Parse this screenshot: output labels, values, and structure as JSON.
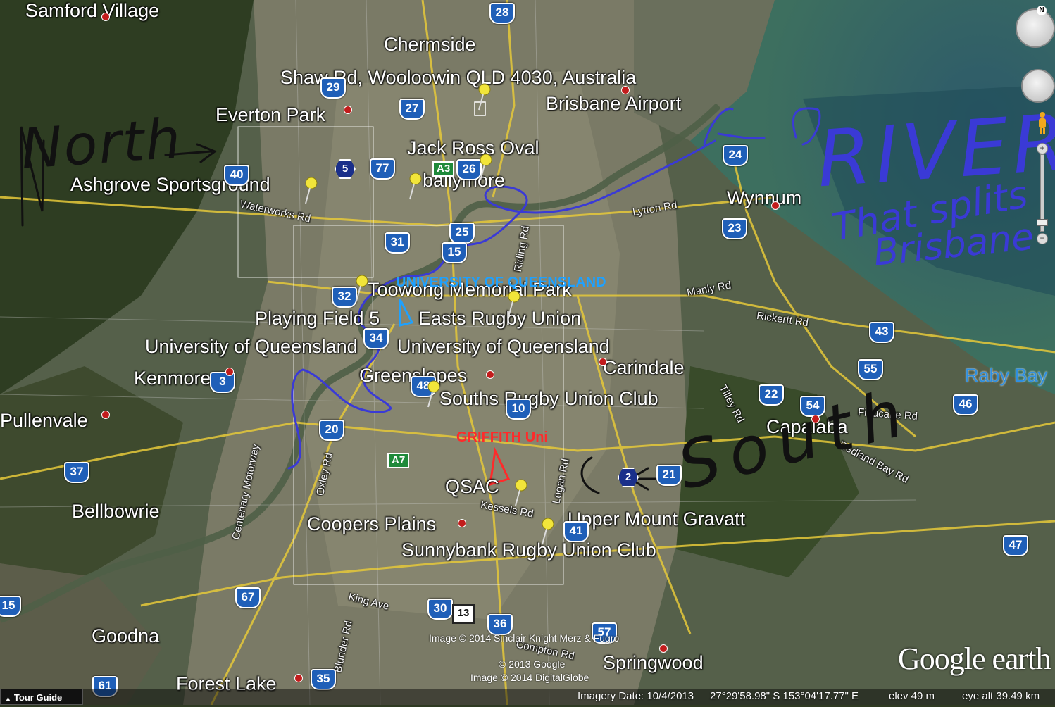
{
  "places": {
    "samford": "Samford Village",
    "chermside": "Chermside",
    "shaw": "Shaw Rd, Wooloowin QLD 4030, Australia",
    "airport": "Brisbane Airport",
    "everton": "Everton Park",
    "jackross": "Jack Ross Oval",
    "ballymore": "ballymore",
    "ashgrove": "Ashgrove Sportsground",
    "wynnum": "Wynnum",
    "toowong": "Toowong Memorial Park",
    "playing5": "Playing Field 5",
    "easts": "Easts Rugby Union",
    "uq1": "University of Queensland",
    "uq2": "University of Queensland",
    "kenmore": "Kenmore",
    "greenslopes": "Greenslopes",
    "carindale": "Carindale",
    "souths": "Souths Rugby Union Club",
    "pullenvale": "Pullenvale",
    "capalaba": "Capalaba",
    "raby": "Raby Bay",
    "qsac": "QSAC",
    "bellbowrie": "Bellbowrie",
    "coopers": "Coopers Plains",
    "umg": "Upper Mount Gravatt",
    "sunnybank": "Sunnybank Rugby Union Club",
    "goodna": "Goodna",
    "springwood": "Springwood",
    "forestlake": "Forest Lake"
  },
  "streets": {
    "waterworks": "Waterworks Rd",
    "lytton": "Lytton Rd",
    "riding": "Riding Rd",
    "manly": "Manly Rd",
    "rickertt": "Rickertt Rd",
    "tilley": "Tilley Rd",
    "finucane": "Finucane Rd",
    "redland": "Redland Bay Rd",
    "centenary": "Centenary Motorway",
    "oxley": "Oxley Rd",
    "logan": "Logan Rd",
    "kessels": "Kessels Rd",
    "kingave": "King Ave",
    "blunder": "Blunder Rd",
    "compton": "Compton Rd"
  },
  "shields": [
    "28",
    "29",
    "27",
    "40",
    "77",
    "26",
    "24",
    "31",
    "25",
    "15",
    "23",
    "32",
    "34",
    "43",
    "55",
    "48",
    "22",
    "54",
    "46",
    "20",
    "10",
    "21",
    "37",
    "41",
    "47",
    "67",
    "30",
    "13",
    "36",
    "57",
    "61",
    "35",
    "15",
    "2",
    "3"
  ],
  "shield_green": [
    "A3",
    "A7"
  ],
  "shield_hex": [
    "5",
    "2"
  ],
  "annotations": {
    "north": "North",
    "south": "South",
    "river": "RIVER",
    "river_sub1": "That splits",
    "river_sub2": "Brisbane",
    "griffith": "GRIFFITH Uni",
    "uq_blue": "UNIVERSITY OF QUEENSLAND"
  },
  "credits": {
    "line1": "Image © 2014 Sinclair Knight Merz & Fugro",
    "line2": "© 2013 Google",
    "line3": "Image © 2014 DigitalGlobe",
    "logo": "Google earth"
  },
  "statusbar": {
    "tour": "Tour Guide",
    "imagery": "Imagery Date: 10/4/2013",
    "coords": "27°29'58.98\" S  153°04'17.77\" E",
    "elev": "elev    49 m",
    "eye": "eye alt  39.49 km"
  },
  "colors": {
    "river_annotation": "#3a3ad6",
    "north_south_annotation": "#111111",
    "griffith": "#ff2a2a",
    "uq": "#1ea1ff"
  }
}
